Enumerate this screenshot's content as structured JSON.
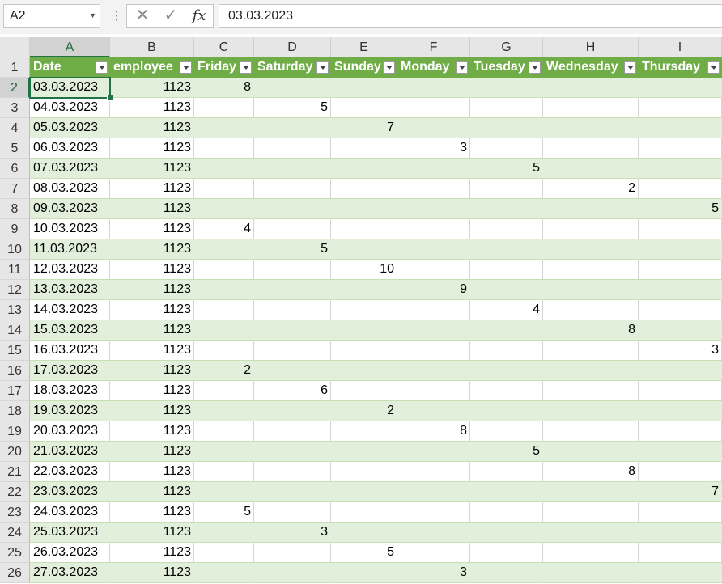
{
  "formula_bar": {
    "name_box": "A2",
    "cancel_icon": "✕",
    "enter_icon": "✓",
    "fx_label": "fx",
    "formula": "03.03.2023"
  },
  "columns": [
    "A",
    "B",
    "C",
    "D",
    "E",
    "F",
    "G",
    "H",
    "I"
  ],
  "table_headers": [
    "Date",
    "employee",
    "Friday",
    "Saturday",
    "Sunday",
    "Monday",
    "Tuesday",
    "Wednesday",
    "Thursday"
  ],
  "rows": [
    {
      "n": "2",
      "date": "03.03.2023",
      "emp": "1123",
      "vals": [
        "8",
        "",
        "",
        "",
        "",
        "",
        ""
      ]
    },
    {
      "n": "3",
      "date": "04.03.2023",
      "emp": "1123",
      "vals": [
        "",
        "5",
        "",
        "",
        "",
        "",
        ""
      ]
    },
    {
      "n": "4",
      "date": "05.03.2023",
      "emp": "1123",
      "vals": [
        "",
        "",
        "7",
        "",
        "",
        "",
        ""
      ]
    },
    {
      "n": "5",
      "date": "06.03.2023",
      "emp": "1123",
      "vals": [
        "",
        "",
        "",
        "3",
        "",
        "",
        ""
      ]
    },
    {
      "n": "6",
      "date": "07.03.2023",
      "emp": "1123",
      "vals": [
        "",
        "",
        "",
        "",
        "5",
        "",
        ""
      ]
    },
    {
      "n": "7",
      "date": "08.03.2023",
      "emp": "1123",
      "vals": [
        "",
        "",
        "",
        "",
        "",
        "2",
        ""
      ]
    },
    {
      "n": "8",
      "date": "09.03.2023",
      "emp": "1123",
      "vals": [
        "",
        "",
        "",
        "",
        "",
        "",
        "5"
      ]
    },
    {
      "n": "9",
      "date": "10.03.2023",
      "emp": "1123",
      "vals": [
        "4",
        "",
        "",
        "",
        "",
        "",
        ""
      ]
    },
    {
      "n": "10",
      "date": "11.03.2023",
      "emp": "1123",
      "vals": [
        "",
        "5",
        "",
        "",
        "",
        "",
        ""
      ]
    },
    {
      "n": "11",
      "date": "12.03.2023",
      "emp": "1123",
      "vals": [
        "",
        "",
        "10",
        "",
        "",
        "",
        ""
      ]
    },
    {
      "n": "12",
      "date": "13.03.2023",
      "emp": "1123",
      "vals": [
        "",
        "",
        "",
        "9",
        "",
        "",
        ""
      ]
    },
    {
      "n": "13",
      "date": "14.03.2023",
      "emp": "1123",
      "vals": [
        "",
        "",
        "",
        "",
        "4",
        "",
        ""
      ]
    },
    {
      "n": "14",
      "date": "15.03.2023",
      "emp": "1123",
      "vals": [
        "",
        "",
        "",
        "",
        "",
        "8",
        ""
      ]
    },
    {
      "n": "15",
      "date": "16.03.2023",
      "emp": "1123",
      "vals": [
        "",
        "",
        "",
        "",
        "",
        "",
        "3"
      ]
    },
    {
      "n": "16",
      "date": "17.03.2023",
      "emp": "1123",
      "vals": [
        "2",
        "",
        "",
        "",
        "",
        "",
        ""
      ]
    },
    {
      "n": "17",
      "date": "18.03.2023",
      "emp": "1123",
      "vals": [
        "",
        "6",
        "",
        "",
        "",
        "",
        ""
      ]
    },
    {
      "n": "18",
      "date": "19.03.2023",
      "emp": "1123",
      "vals": [
        "",
        "",
        "2",
        "",
        "",
        "",
        ""
      ]
    },
    {
      "n": "19",
      "date": "20.03.2023",
      "emp": "1123",
      "vals": [
        "",
        "",
        "",
        "8",
        "",
        "",
        ""
      ]
    },
    {
      "n": "20",
      "date": "21.03.2023",
      "emp": "1123",
      "vals": [
        "",
        "",
        "",
        "",
        "5",
        "",
        ""
      ]
    },
    {
      "n": "21",
      "date": "22.03.2023",
      "emp": "1123",
      "vals": [
        "",
        "",
        "",
        "",
        "",
        "8",
        ""
      ]
    },
    {
      "n": "22",
      "date": "23.03.2023",
      "emp": "1123",
      "vals": [
        "",
        "",
        "",
        "",
        "",
        "",
        "7"
      ]
    },
    {
      "n": "23",
      "date": "24.03.2023",
      "emp": "1123",
      "vals": [
        "5",
        "",
        "",
        "",
        "",
        "",
        ""
      ]
    },
    {
      "n": "24",
      "date": "25.03.2023",
      "emp": "1123",
      "vals": [
        "",
        "3",
        "",
        "",
        "",
        "",
        ""
      ]
    },
    {
      "n": "25",
      "date": "26.03.2023",
      "emp": "1123",
      "vals": [
        "",
        "",
        "5",
        "",
        "",
        "",
        ""
      ]
    },
    {
      "n": "26",
      "date": "27.03.2023",
      "emp": "1123",
      "vals": [
        "",
        "",
        "",
        "3",
        "",
        "",
        ""
      ]
    }
  ],
  "header_row_number": "1",
  "colors": {
    "table_header": "#70ad47",
    "band": "#e2efda",
    "selection": "#217346"
  }
}
